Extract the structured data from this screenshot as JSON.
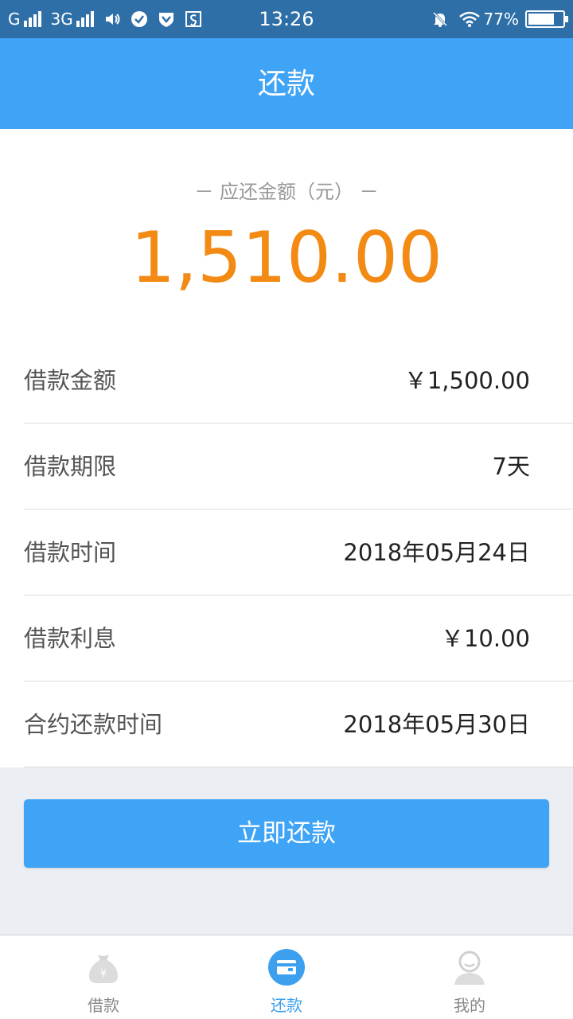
{
  "status_bar": {
    "carrier1": "G",
    "carrier2": "3G",
    "time": "13:26",
    "battery": "77%",
    "battery_level": 0.77
  },
  "header": {
    "title": "还款"
  },
  "summary": {
    "label": "－ 应还金额（元） －",
    "amount": "1,510.00"
  },
  "details": [
    {
      "label": "借款金额",
      "value": "￥1,500.00"
    },
    {
      "label": "借款期限",
      "value": "7天"
    },
    {
      "label": "借款时间",
      "value": "2018年05月24日"
    },
    {
      "label": "借款利息",
      "value": "￥10.00"
    },
    {
      "label": "合约还款时间",
      "value": "2018年05月30日"
    }
  ],
  "actions": {
    "repay_label": "立即还款"
  },
  "tabs": [
    {
      "label": "借款",
      "icon": "money-bag-icon"
    },
    {
      "label": "还款",
      "icon": "wallet-icon",
      "active": true
    },
    {
      "label": "我的",
      "icon": "user-icon"
    }
  ],
  "colors": {
    "primary": "#40a4f6",
    "status_bar": "#2f6fa8",
    "amount": "#f28a14",
    "background": "#ebeef2"
  }
}
